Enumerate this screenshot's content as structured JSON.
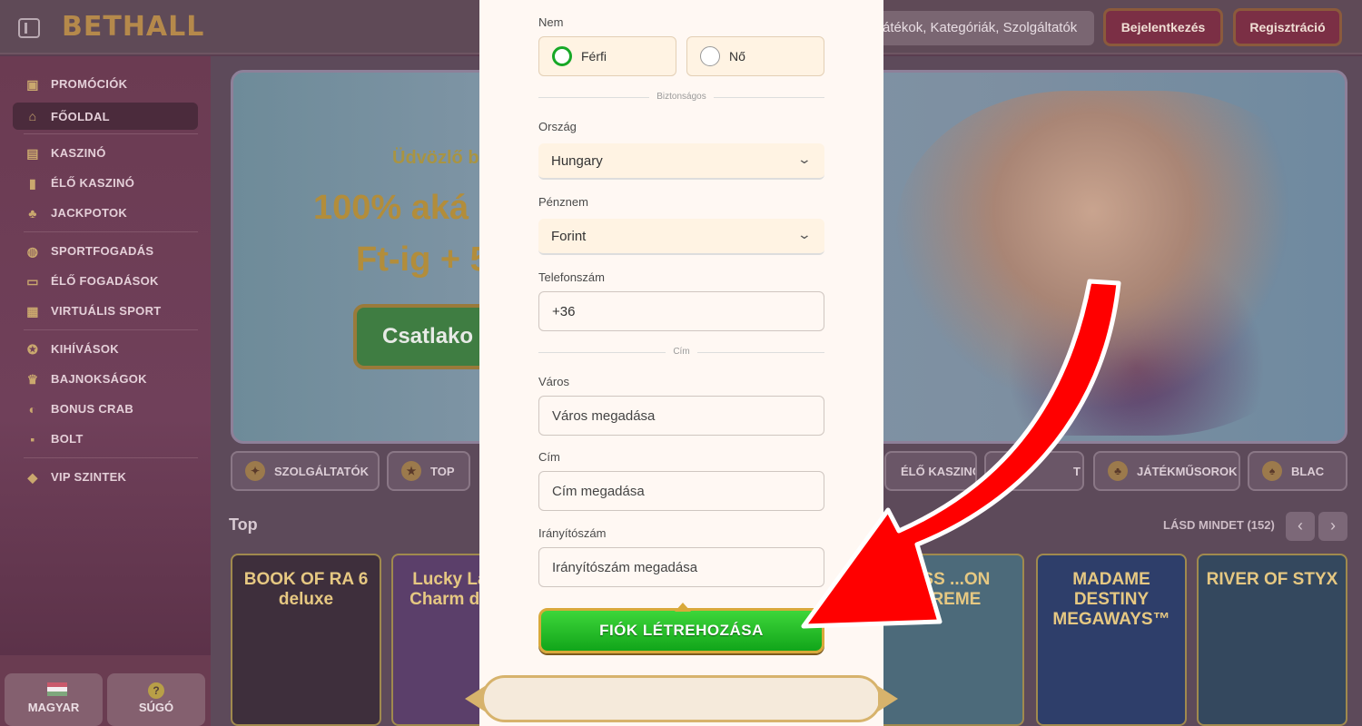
{
  "header": {
    "brand": "BETHALL",
    "search_text": "átékok, Kategóriák, Szolgáltatók",
    "login_label": "Bejelentkezés",
    "register_label": "Regisztráció"
  },
  "sidebar": {
    "items": [
      {
        "label": "PROMÓCIÓK",
        "icon": "gift-icon"
      },
      {
        "label": "FŐOLDAL",
        "icon": "home-icon"
      },
      {
        "label": "KASZINÓ",
        "icon": "slot-icon"
      },
      {
        "label": "ÉLŐ KASZINÓ",
        "icon": "card-icon"
      },
      {
        "label": "JACKPOTOK",
        "icon": "clover-icon"
      },
      {
        "label": "SPORTFOGADÁS",
        "icon": "ball-icon"
      },
      {
        "label": "ÉLŐ FOGADÁSOK",
        "icon": "live-icon"
      },
      {
        "label": "VIRTUÁLIS SPORT",
        "icon": "virtual-icon"
      },
      {
        "label": "KIHÍVÁSOK",
        "icon": "medal-icon"
      },
      {
        "label": "BAJNOKSÁGOK",
        "icon": "trophy-icon"
      },
      {
        "label": "BONUS CRAB",
        "icon": "crab-icon"
      },
      {
        "label": "BOLT",
        "icon": "bag-icon"
      },
      {
        "label": "VIP SZINTEK",
        "icon": "diamond-icon"
      }
    ],
    "language_label": "MAGYAR",
    "help_label": "SÚGÓ",
    "help_glyph": "?"
  },
  "banner": {
    "line1": "Üdvözlő b",
    "line2": "100% aká",
    "line3": "Ft-ig + 5",
    "cta_label": "Csatlako"
  },
  "categories": [
    {
      "label": "SZOLGÁLTATÓK",
      "glyph": "✦"
    },
    {
      "label": "TOP",
      "glyph": "★"
    },
    {
      "label": "ÉLŐ KASZINÓ",
      "glyph": ""
    },
    {
      "label": "T",
      "glyph": ""
    },
    {
      "label": "JÁTÉKMŰSOROK",
      "glyph": "♣"
    },
    {
      "label": "BLAC",
      "glyph": "♠"
    }
  ],
  "section": {
    "title": "Top",
    "see_all": "LÁSD MINDET (152)",
    "prev_glyph": "‹",
    "next_glyph": "›"
  },
  "games": [
    {
      "title": "BOOK OF RA 6 deluxe"
    },
    {
      "title": "Lucky Lady's Charm deluxe"
    },
    {
      "title": ""
    },
    {
      "title": ""
    },
    {
      "title": "...SS ...ON ...REME"
    },
    {
      "title": "MADAME DESTINY MEGAWAYS™"
    },
    {
      "title": "RIVER OF STYX"
    }
  ],
  "form": {
    "gender_label": "Nem",
    "gender_options": [
      "Férfi",
      "Nő"
    ],
    "gender_selected": "Férfi",
    "divider_security": "Biztonságos",
    "country_label": "Ország",
    "country_value": "Hungary",
    "currency_label": "Pénznem",
    "currency_value": "Forint",
    "phone_label": "Telefonszám",
    "phone_value": "+36",
    "divider_address": "Cím",
    "city_label": "Város",
    "city_placeholder": "Város megadása",
    "address_label": "Cím",
    "address_placeholder": "Cím megadása",
    "zip_label": "Irányítószám",
    "zip_placeholder": "Irányítószám megadása",
    "submit_label": "FIÓK LÉTREHOZÁSA",
    "chevron_glyph": "⌄"
  },
  "colors": {
    "accent_green": "#17a827",
    "annotation_red": "#ff0000",
    "submit_border": "#d9a93a"
  }
}
